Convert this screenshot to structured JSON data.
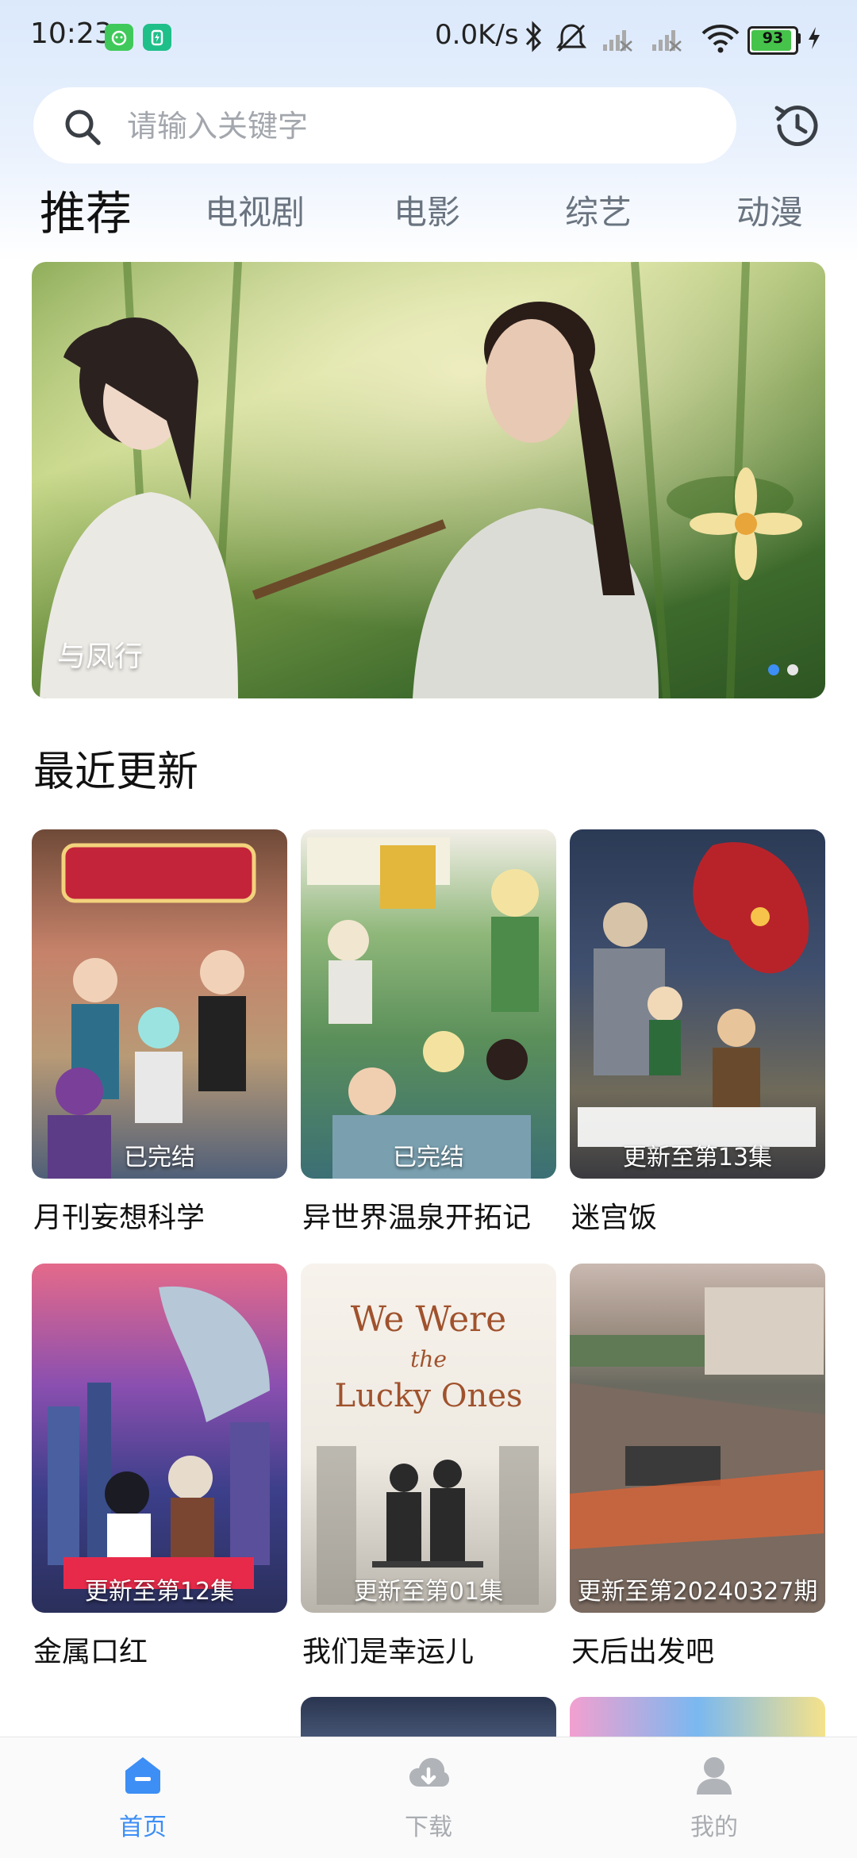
{
  "status_bar": {
    "time": "10:23",
    "net_speed": "0.0K/s",
    "battery": "93"
  },
  "search": {
    "placeholder": "请输入关键字",
    "icon": "search-icon"
  },
  "history": {
    "icon": "history-icon"
  },
  "tabs": [
    {
      "label": "推荐",
      "active": true
    },
    {
      "label": "电视剧",
      "active": false
    },
    {
      "label": "电影",
      "active": false
    },
    {
      "label": "综艺",
      "active": false
    },
    {
      "label": "动漫",
      "active": false
    }
  ],
  "banner": {
    "title": "与凤行",
    "page_count": 2,
    "current_page": 1
  },
  "recent": {
    "title": "最近更新",
    "items": [
      {
        "title": "月刊妄想科学",
        "status": "已完结"
      },
      {
        "title": "异世界温泉开拓记",
        "status": "已完结"
      },
      {
        "title": "迷宫饭",
        "status": "更新至第13集"
      },
      {
        "title": "金属口红",
        "status": "更新至第12集"
      },
      {
        "title": "我们是幸运儿",
        "status": "更新至第01集"
      },
      {
        "title": "天后出发吧",
        "status": "更新至第20240327期"
      }
    ]
  },
  "bottom_nav": [
    {
      "label": "首页",
      "icon": "home-icon",
      "active": true
    },
    {
      "label": "下载",
      "icon": "download-icon",
      "active": false
    },
    {
      "label": "我的",
      "icon": "profile-icon",
      "active": false
    }
  ],
  "colors": {
    "accent": "#3d8ef5",
    "inactive": "#a9acb1",
    "tab_inactive": "#6a7480"
  }
}
